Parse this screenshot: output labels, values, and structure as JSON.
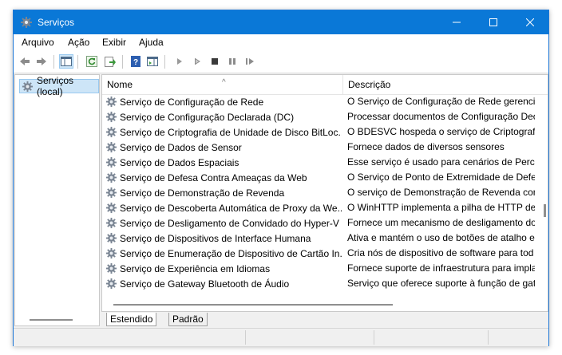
{
  "window": {
    "title": "Serviços"
  },
  "menu": [
    "Arquivo",
    "Ação",
    "Exibir",
    "Ajuda"
  ],
  "tree": {
    "root_label": "Serviços (local)"
  },
  "columns": {
    "name": "Nome",
    "description": "Descrição"
  },
  "rows": [
    {
      "name": "Serviço de Configuração de Rede",
      "description": "O Serviço de Configuração de Rede gerencia"
    },
    {
      "name": "Serviço de Configuração Declarada (DC)",
      "description": "Processar documentos de Configuração Dec"
    },
    {
      "name": "Serviço de Criptografia de Unidade de Disco BitLoc...",
      "description": "O BDESVC hospeda o serviço de Criptografia"
    },
    {
      "name": "Serviço de Dados de Sensor",
      "description": "Fornece dados de diversos sensores"
    },
    {
      "name": "Serviço de Dados Espaciais",
      "description": "Esse serviço é usado para cenários de Percep"
    },
    {
      "name": "Serviço de Defesa Contra Ameaças da Web",
      "description": "O Serviço de Ponto de Extremidade de Defes"
    },
    {
      "name": "Serviço de Demonstração de Revenda",
      "description": "O serviço de Demonstração de Revenda con"
    },
    {
      "name": "Serviço de Descoberta Automática de Proxy da We...",
      "description": "O WinHTTP implementa a pilha de HTTP de"
    },
    {
      "name": "Serviço de Desligamento de Convidado do Hyper-V",
      "description": "Fornece um mecanismo de desligamento do"
    },
    {
      "name": "Serviço de Dispositivos de Interface Humana",
      "description": "Ativa e mantém o uso de botões de atalho e"
    },
    {
      "name": "Serviço de Enumeração de Dispositivo de Cartão In...",
      "description": "Cria nós de dispositivo de software para tod"
    },
    {
      "name": "Serviço de Experiência em Idiomas",
      "description": "Fornece suporte de infraestrutura para impla"
    },
    {
      "name": "Serviço de Gateway Bluetooth de Áudio",
      "description": "Serviço que oferece suporte à função de gat"
    }
  ],
  "tabs": {
    "extended": "Estendido",
    "standard": "Padrão"
  },
  "colors": {
    "titlebar": "#0a78d7",
    "selection": "#cde5f7"
  }
}
